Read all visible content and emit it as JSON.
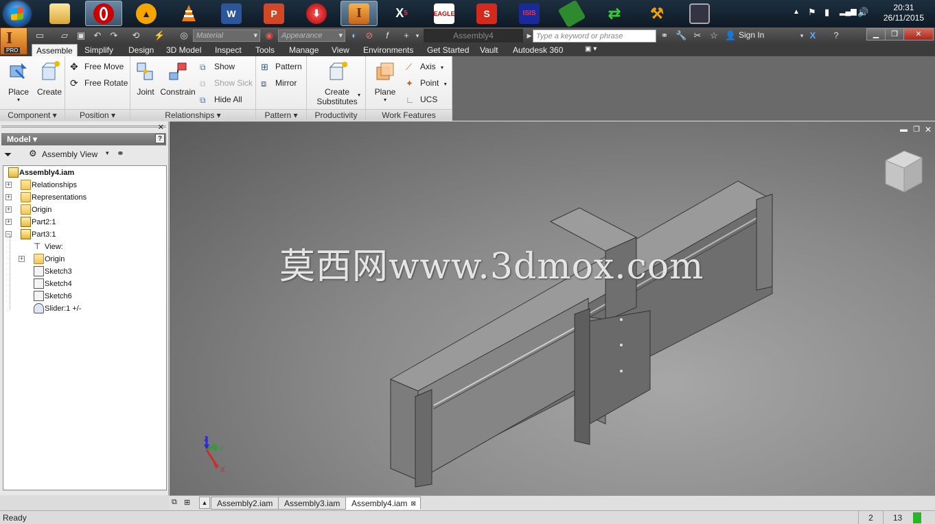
{
  "taskbar": {
    "apps": [
      "file-explorer",
      "opera",
      "vlc-alt",
      "vlc",
      "word",
      "powerpoint",
      "downloader",
      "autodesk-inventor",
      "x5",
      "cadsoft-eagle",
      "sketchup",
      "proteus",
      "circuit-board",
      "green-arrows",
      "orange-app",
      "monitor-app"
    ],
    "clock_time": "20:31",
    "clock_date": "26/11/2015"
  },
  "app": {
    "button_letter": "I",
    "button_badge": "PRO",
    "material_placeholder": "Material",
    "appearance_placeholder": "Appearance",
    "document_title": "Assembly4",
    "search_placeholder": "Type a keyword or phrase",
    "sign_in_label": "Sign In"
  },
  "ribbon": {
    "tabs": [
      "Assemble",
      "Simplify",
      "Design",
      "3D Model",
      "Inspect",
      "Tools",
      "Manage",
      "View",
      "Environments",
      "Get Started",
      "Vault",
      "Autodesk 360"
    ],
    "active_tab": "Assemble",
    "component": {
      "title": "Component",
      "place": "Place",
      "create": "Create"
    },
    "position": {
      "title": "Position",
      "free_move": "Free Move",
      "free_rotate": "Free Rotate"
    },
    "relationships": {
      "title": "Relationships",
      "joint": "Joint",
      "constrain": "Constrain",
      "show": "Show",
      "show_sick": "Show Sick",
      "hide_all": "Hide All"
    },
    "pattern": {
      "title": "Pattern",
      "pattern": "Pattern",
      "mirror": "Mirror"
    },
    "productivity": {
      "title": "Productivity",
      "create_line1": "Create",
      "create_line2": "Substitutes"
    },
    "work_features": {
      "title": "Work Features",
      "plane": "Plane",
      "axis": "Axis",
      "point": "Point",
      "ucs": "UCS"
    }
  },
  "browser": {
    "header": "Model",
    "view_label": "Assembly View",
    "tree": [
      {
        "label": "Assembly4.iam",
        "bold": true
      },
      {
        "label": "Relationships"
      },
      {
        "label": "Representations"
      },
      {
        "label": "Origin"
      },
      {
        "label": "Part2:1"
      },
      {
        "label": "Part3:1"
      },
      {
        "label": "View:"
      },
      {
        "label": "Origin"
      },
      {
        "label": "Sketch3"
      },
      {
        "label": "Sketch4"
      },
      {
        "label": "Sketch6"
      },
      {
        "label": "Slider:1 +/-"
      }
    ]
  },
  "viewport": {
    "watermark": "莫西网www.3dmox.com",
    "triad": {
      "x": "X",
      "y": "Y",
      "z": "Z"
    },
    "colors": {
      "body": "#8a8a8a",
      "edge": "#3a3a3a",
      "x_axis": "#d22",
      "y_axis": "#2a2",
      "z_axis": "#22c"
    }
  },
  "document_tabs": [
    "Assembly2.iam",
    "Assembly3.iam",
    "Assembly4.iam"
  ],
  "active_document": "Assembly4.iam",
  "status": {
    "text": "Ready",
    "count_a": "2",
    "count_b": "13"
  }
}
